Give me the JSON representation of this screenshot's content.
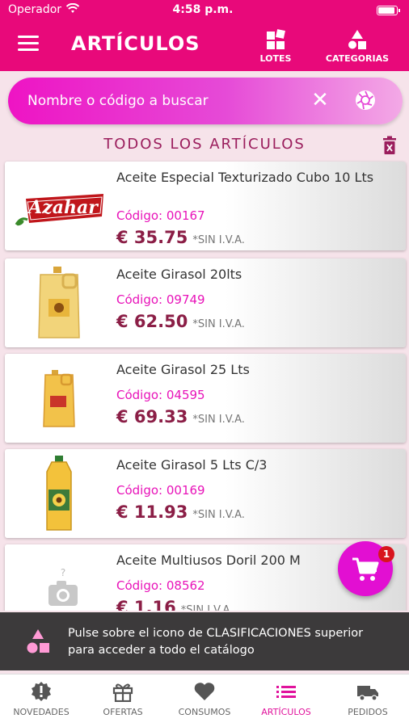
{
  "status_bar": {
    "carrier": "Operador",
    "time": "4:58 p.m."
  },
  "header": {
    "title": "ARTÍCULOS",
    "lotes_label": "LOTES",
    "categorias_label": "CATEGORIAS"
  },
  "search": {
    "placeholder": "Nombre o código a buscar"
  },
  "section_title": "TODOS LOS ARTÍCULOS",
  "code_label": "Código:",
  "products": [
    {
      "name": "Aceite Especial Texturizado Cubo 10 Lts",
      "code": "00167",
      "price": "€ 35.75",
      "vat": "*SIN I.V.A.",
      "brand": "Azahar"
    },
    {
      "name": "Aceite Girasol 20lts",
      "code": "09749",
      "price": "€ 62.50",
      "vat": "*SIN I.V.A."
    },
    {
      "name": "Aceite Girasol 25 Lts",
      "code": "04595",
      "price": "€ 69.33",
      "vat": "*SIN I.V.A."
    },
    {
      "name": "Aceite Girasol 5 Lts C/3",
      "code": "00169",
      "price": "€ 11.93",
      "vat": "*SIN I.V.A."
    },
    {
      "name": "Aceite Multiusos Doril 200 M",
      "code": "08562",
      "price": "€ 1.16",
      "vat": "*SIN I.V.A."
    }
  ],
  "cart": {
    "count": "1"
  },
  "toast": {
    "message": "Pulse sobre el icono de CLASIFICACIONES superior para acceder a todo el catálogo"
  },
  "tabs": [
    {
      "label": "NOVEDADES",
      "icon": "alert-badge-icon"
    },
    {
      "label": "OFERTAS",
      "icon": "gift-icon"
    },
    {
      "label": "CONSUMOS",
      "icon": "heart-icon"
    },
    {
      "label": "ARTÍCULOS",
      "icon": "list-icon",
      "active": true
    },
    {
      "label": "PEDIDOS",
      "icon": "truck-icon"
    }
  ],
  "colors": {
    "brand": "#e8097a",
    "accent": "#e813b9",
    "price": "#8b1e46",
    "section": "#9b1e5d"
  }
}
